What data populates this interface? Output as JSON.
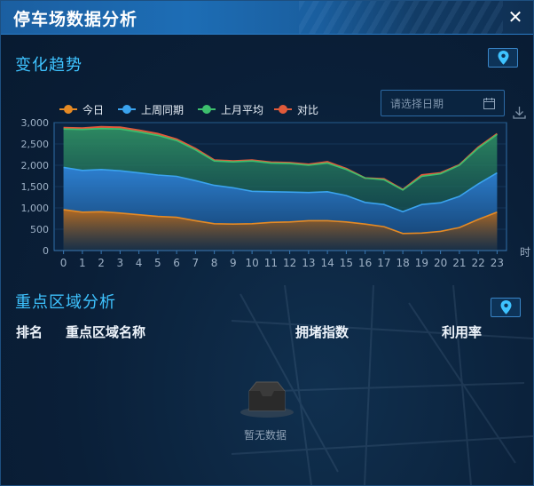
{
  "window": {
    "title": "停车场数据分析",
    "close_glyph": "✕"
  },
  "trend": {
    "section_title": "变化趋势",
    "legend": [
      {
        "name": "今日",
        "color": "#e58a24"
      },
      {
        "name": "上周同期",
        "color": "#3aa3ee"
      },
      {
        "name": "上月平均",
        "color": "#3dbf6d"
      },
      {
        "name": "对比",
        "color": "#e05a3a"
      }
    ],
    "date_placeholder": "请选择日期",
    "icons": {
      "locate": "map-pin-icon",
      "calendar": "calendar-icon",
      "download": "download-icon"
    }
  },
  "region": {
    "section_title": "重点区域分析",
    "columns": [
      "排名",
      "重点区域名称",
      "拥堵指数",
      "利用率"
    ],
    "empty_text": "暂无数据"
  },
  "chart_data": {
    "type": "area",
    "x": [
      0,
      1,
      2,
      3,
      4,
      5,
      6,
      7,
      8,
      9,
      10,
      11,
      12,
      13,
      14,
      15,
      16,
      17,
      18,
      19,
      20,
      21,
      22,
      23
    ],
    "x_unit_label": "时",
    "ylim": [
      0,
      3000
    ],
    "yticks": [
      0,
      500,
      1000,
      1500,
      2000,
      2500,
      3000
    ],
    "ytick_labels": [
      "0",
      "500",
      "1,000",
      "1,500",
      "2,000",
      "2,500",
      "3,000"
    ],
    "grid": true,
    "series": [
      {
        "name": "今日",
        "color": "#e58a24",
        "values": [
          960,
          900,
          910,
          880,
          840,
          800,
          780,
          700,
          630,
          620,
          630,
          660,
          670,
          700,
          700,
          670,
          620,
          560,
          400,
          410,
          450,
          540,
          730,
          900
        ]
      },
      {
        "name": "上周同期",
        "color": "#3aa3ee",
        "values": [
          1950,
          1880,
          1900,
          1870,
          1820,
          1770,
          1740,
          1640,
          1530,
          1470,
          1390,
          1380,
          1370,
          1360,
          1380,
          1290,
          1130,
          1080,
          910,
          1080,
          1120,
          1270,
          1560,
          1820
        ]
      },
      {
        "name": "上月平均",
        "color": "#3dbf6d",
        "values": [
          2850,
          2840,
          2860,
          2850,
          2780,
          2700,
          2580,
          2360,
          2100,
          2080,
          2100,
          2050,
          2040,
          2000,
          2050,
          1900,
          1700,
          1660,
          1420,
          1740,
          1800,
          2000,
          2400,
          2720
        ]
      },
      {
        "name": "对比",
        "color": "#e05a3a",
        "values": [
          2880,
          2870,
          2900,
          2890,
          2820,
          2740,
          2610,
          2390,
          2120,
          2100,
          2120,
          2070,
          2060,
          2020,
          2080,
          1920,
          1700,
          1680,
          1430,
          1770,
          1820,
          2010,
          2420,
          2740
        ]
      }
    ]
  }
}
